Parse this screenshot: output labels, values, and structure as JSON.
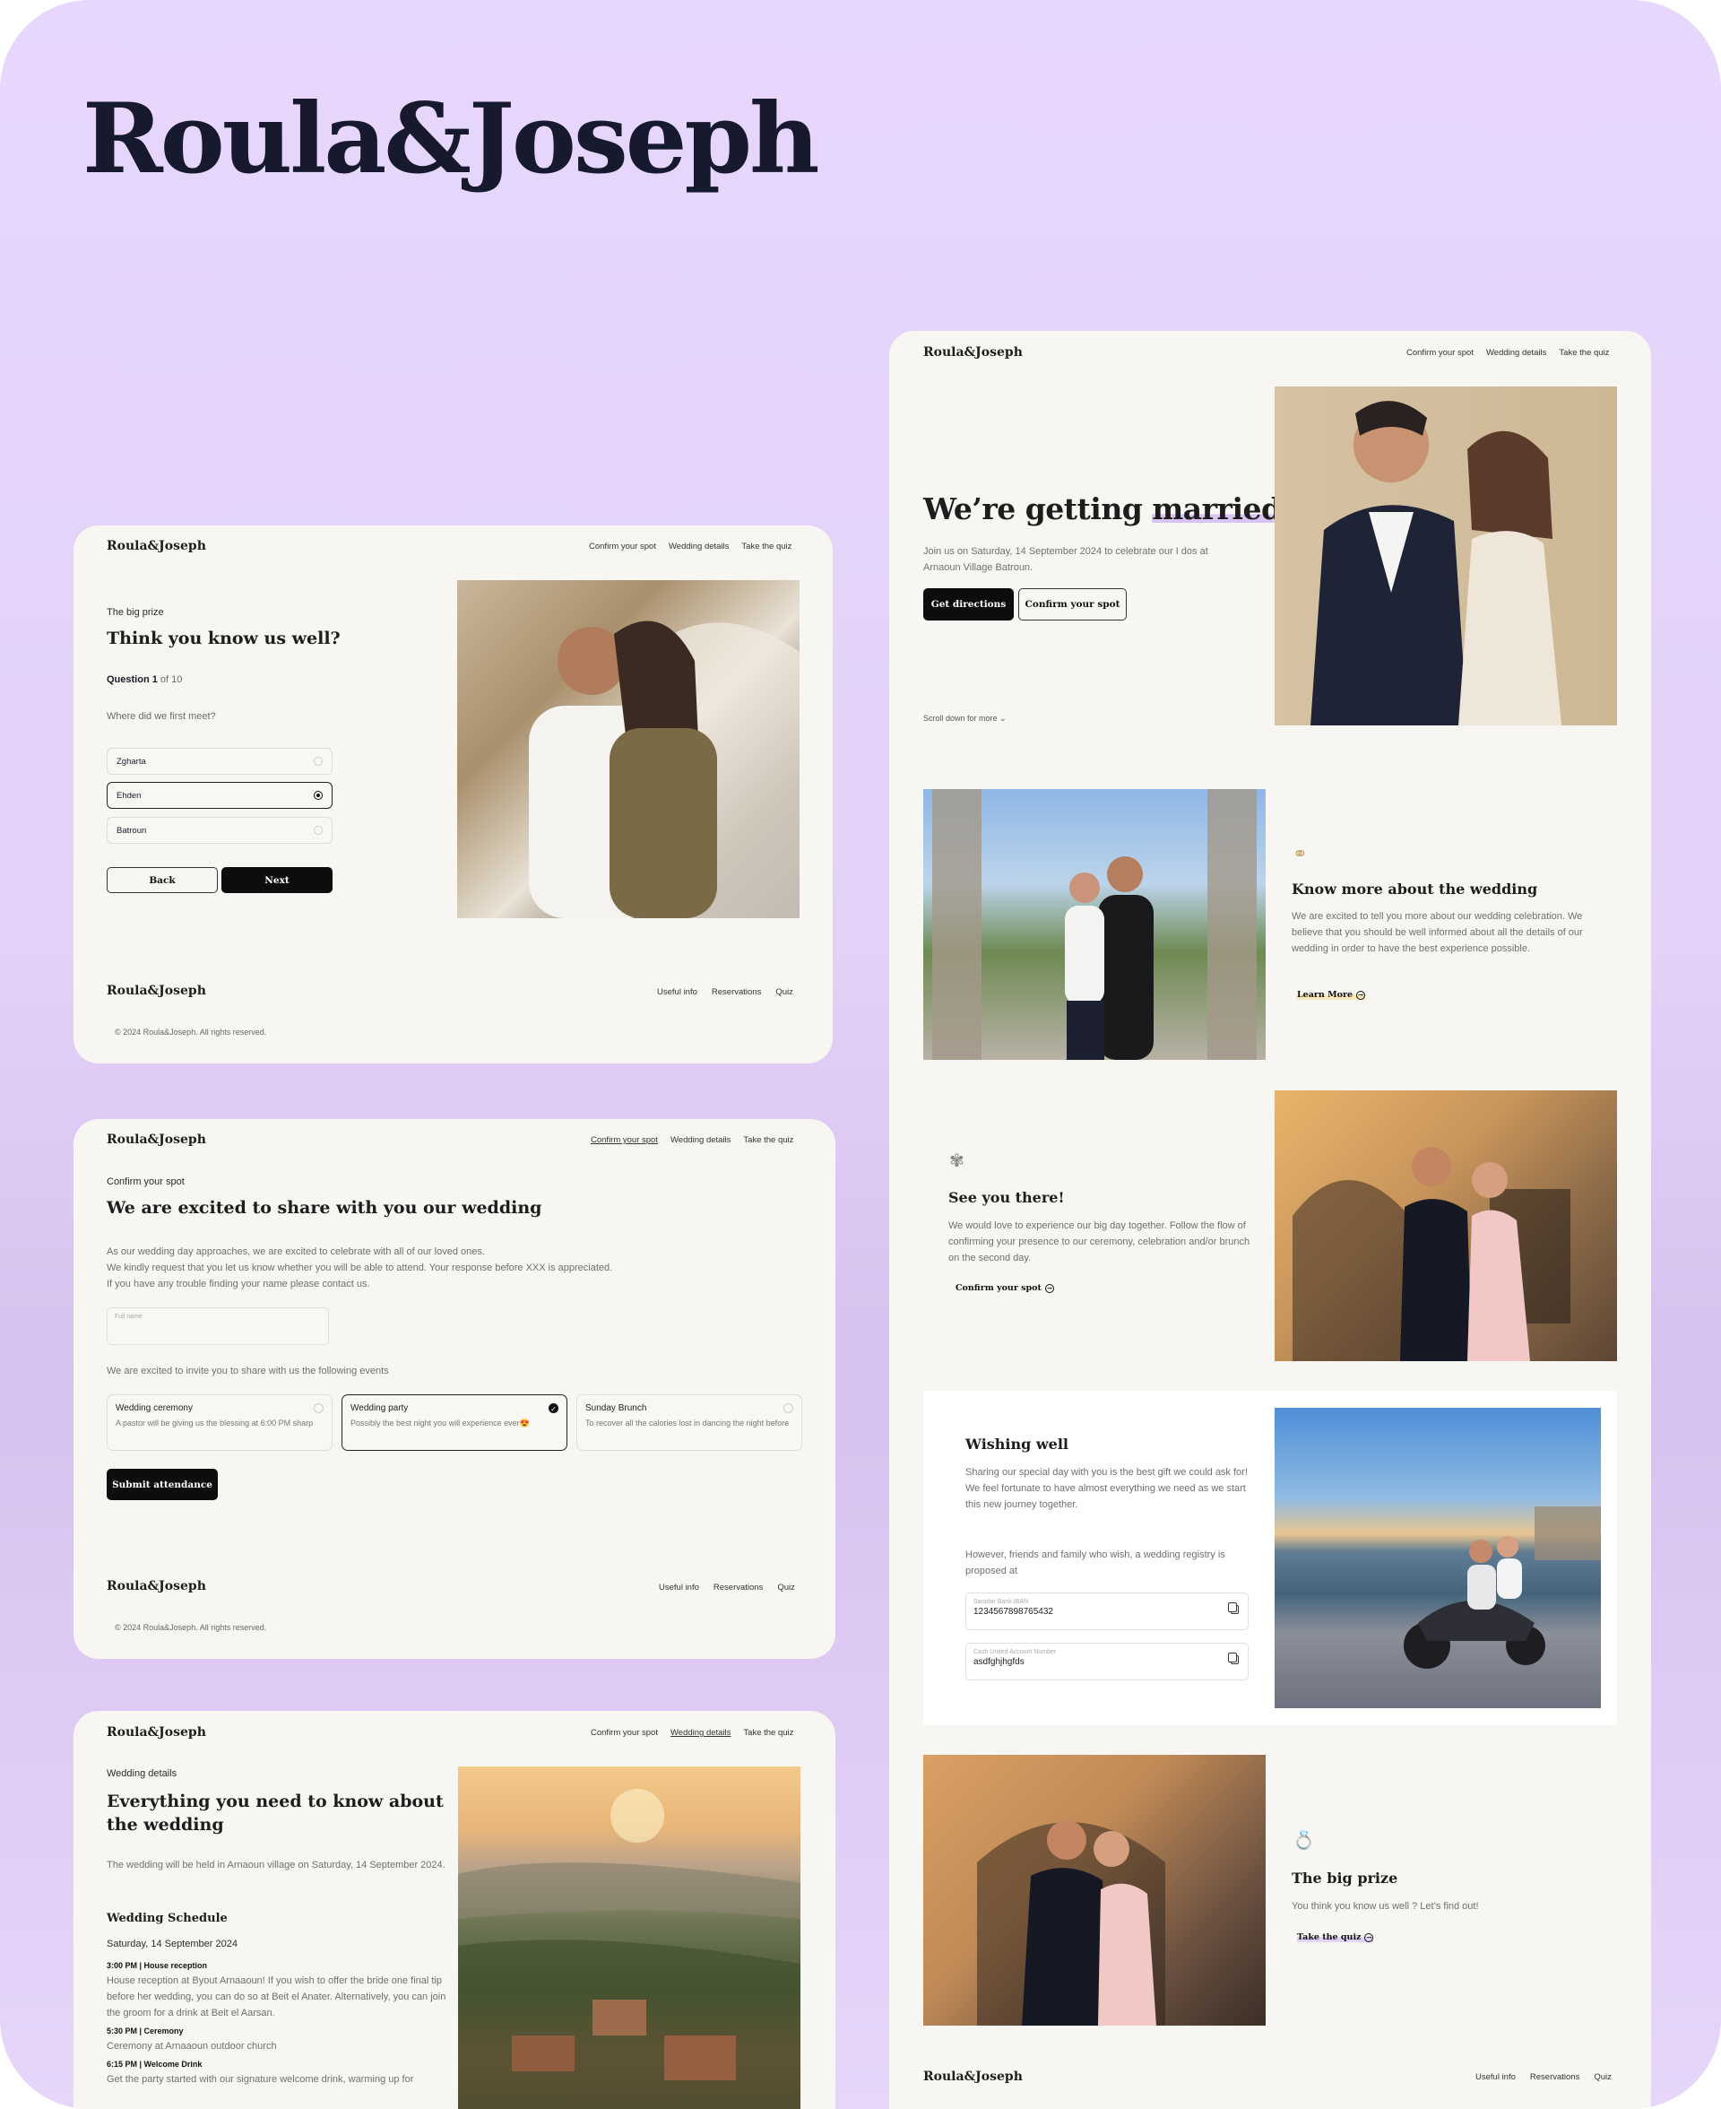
{
  "showcase": {
    "title": "Roula&Joseph"
  },
  "brand": "Roula&Joseph",
  "nav": {
    "confirm": "Confirm your spot",
    "details": "Wedding details",
    "quiz": "Take the quiz"
  },
  "footer": {
    "useful": "Useful info",
    "reservations": "Reservations",
    "quiz": "Quiz",
    "copyright": "© 2024 Roula&Joseph. All rights reserved."
  },
  "quiz_page": {
    "eyebrow": "The big prize",
    "title": "Think you know us well?",
    "question_label": "Question 1",
    "question_of": " of 10",
    "question": "Where did we first meet?",
    "options": [
      "Zgharta",
      "Ehden",
      "Batroun"
    ],
    "selected_option": "Ehden",
    "back": "Back",
    "next": "Next"
  },
  "confirm_page": {
    "eyebrow": "Confirm your spot",
    "title": "We are excited to share with you our wedding",
    "intro_1": "As our wedding day approaches, we are excited to celebrate with all of our loved ones.",
    "intro_2": "We kindly request that you let us know whether you will be able to attend. Your response before XXX is appreciated.",
    "intro_3": "If you have any trouble finding your name please contact us.",
    "name_placeholder": "Full name",
    "invite_text": "We are excited to invite you to share with us the following events",
    "events": [
      {
        "title": "Wedding ceremony",
        "desc": "A pastor will be giving us the blessing at 6:00 PM sharp",
        "checked": false
      },
      {
        "title": "Wedding party",
        "desc": "Possibly the best night you will experience ever😍",
        "checked": true
      },
      {
        "title": "Sunday Brunch",
        "desc": "To recover all the calories lost in dancing the night before",
        "checked": false
      }
    ],
    "submit": "Submit attendance"
  },
  "details_page": {
    "eyebrow": "Wedding details",
    "title": "Everything you need to know about the wedding",
    "intro": "The wedding will be held in Arnaoun village on Saturday, 14 September 2024.",
    "schedule_title": "Wedding Schedule",
    "schedule_date": "Saturday, 14 September 2024",
    "items": [
      {
        "time": "3:00 PM | House reception",
        "desc": "House reception at Byout Arnaaoun! If you wish to offer the bride one final tip before her wedding, you can do so at Beit el Anater. Alternatively, you can join the groom for a drink at Beit el Aarsan."
      },
      {
        "time": "5:30 PM | Ceremony",
        "desc": "Ceremony at Arnaaoun outdoor church"
      },
      {
        "time": "6:15 PM | Welcome Drink",
        "desc": "Get the party started with our signature welcome drink, warming up for"
      }
    ]
  },
  "home_page": {
    "hero_title_1": "We’re getting ",
    "hero_title_2": "married",
    "hero_sub": "Join us on Saturday, 14 September 2024  to celebrate our I dos at Arnaoun Village Batroun.",
    "btn_directions": "Get directions",
    "btn_confirm": "Confirm your spot",
    "scroll": "Scroll down for more",
    "know_title": "Know more about the wedding",
    "know_text": "We are excited to tell you more about our wedding celebration. We believe that you should be well informed about all the details of our wedding in order to have the best experience possible.",
    "know_link": "Learn More",
    "see_title": "See you there!",
    "see_text": "We would love to experience our big day together. Follow the flow of confirming your presence to our ceremony, celebration and/or brunch on the second day.",
    "see_link": "Confirm your spot",
    "wish_title": "Wishing well",
    "wish_text": "Sharing our special day with you is the best gift we could ask for! We feel fortunate to have almost everything we need as we start this new journey together.",
    "wish_text2": "However, friends and family who wish, a wedding registry is proposed at",
    "account1_label": "Saradar Bank IBAN",
    "account1_value": "1234567898765432",
    "account2_label": "Cash United Account Number",
    "account2_value": "asdfghjhgfds",
    "prize_title": "The big prize",
    "prize_text": "You think you know us well ? Let’s find out!",
    "prize_link": "Take the quiz"
  }
}
